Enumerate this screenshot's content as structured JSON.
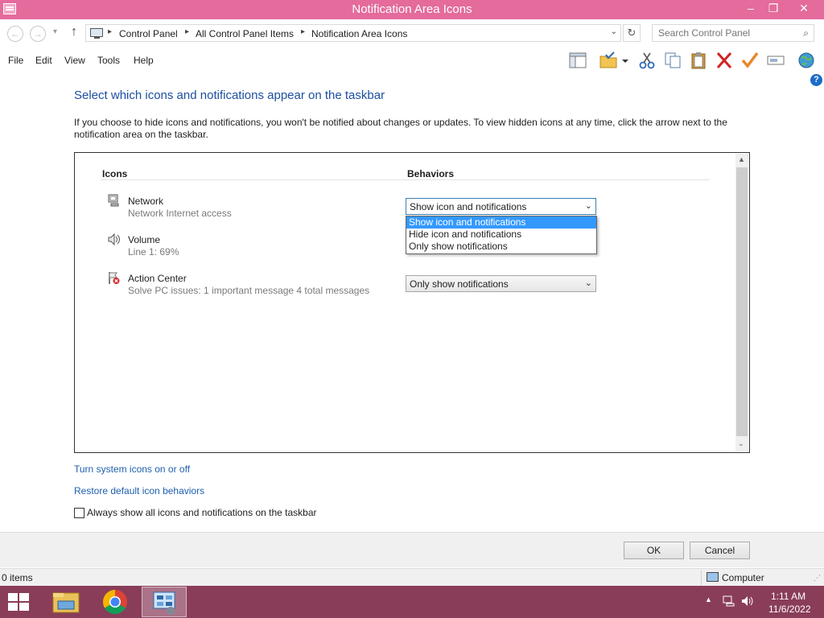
{
  "window": {
    "title": "Notification Area Icons",
    "minimize": "–",
    "restore": "❐",
    "close": "✕"
  },
  "address": {
    "back": "←",
    "forward": "→",
    "history_arrow": "▾",
    "up": "↑",
    "crumbs": [
      "Control Panel",
      "All Control Panel Items",
      "Notification Area Icons"
    ],
    "separator": "▸",
    "dropdown_arrow": "⌄",
    "refresh": "↻",
    "search_placeholder": "Search Control Panel",
    "search_icon": "⌕"
  },
  "menu": [
    "File",
    "Edit",
    "View",
    "Tools",
    "Help"
  ],
  "toolbar_icons": [
    "layout-icon",
    "properties-folder-icon",
    "cut-icon",
    "copy-icon",
    "paste-icon",
    "delete-icon",
    "checkmark-icon",
    "rename-icon",
    "globe-icon"
  ],
  "help_label": "?",
  "main": {
    "heading": "Select which icons and notifications appear on the taskbar",
    "description": "If you choose to hide icons and notifications, you won't be notified about changes or updates. To view hidden icons at any time, click the arrow next to the notification area on the taskbar.",
    "col_icons": "Icons",
    "col_behaviors": "Behaviors",
    "rows": [
      {
        "name": "Network",
        "sub": "Network Internet access",
        "behavior": "Show icon and notifications",
        "icon": "network-icon"
      },
      {
        "name": "Volume",
        "sub": "Line 1: 69%",
        "behavior": "",
        "icon": "speaker-icon"
      },
      {
        "name": "Action Center",
        "sub": "Solve PC issues: 1 important message  4 total messages",
        "behavior": "Only show notifications",
        "icon": "action-center-flag-icon"
      }
    ],
    "combo_arrow": "⌄",
    "dropdown_options": [
      "Show icon and notifications",
      "Hide icon and notifications",
      "Only show notifications"
    ],
    "dropdown_selected": "Show icon and notifications",
    "scroll_up": "▲",
    "scroll_down": "⌄"
  },
  "links": {
    "system_icons": "Turn system icons on or off",
    "restore_defaults": "Restore default icon behaviors"
  },
  "always_show": {
    "label": "Always show all icons and notifications on the taskbar",
    "checked": false
  },
  "buttons": {
    "ok": "OK",
    "cancel": "Cancel"
  },
  "status": {
    "items": "0 items",
    "location": "Computer",
    "grip": "⋰"
  },
  "taskbar": {
    "apps": [
      "file-explorer-icon",
      "chrome-icon",
      "control-panel-icon"
    ],
    "tray_up": "▲",
    "time": "1:11 AM",
    "date": "11/6/2022"
  },
  "colors": {
    "titlebar": "#e46b9c",
    "taskbar": "#8a3d59",
    "heading": "#1d4fa0",
    "link": "#1d5fae",
    "selection": "#3399ff"
  }
}
